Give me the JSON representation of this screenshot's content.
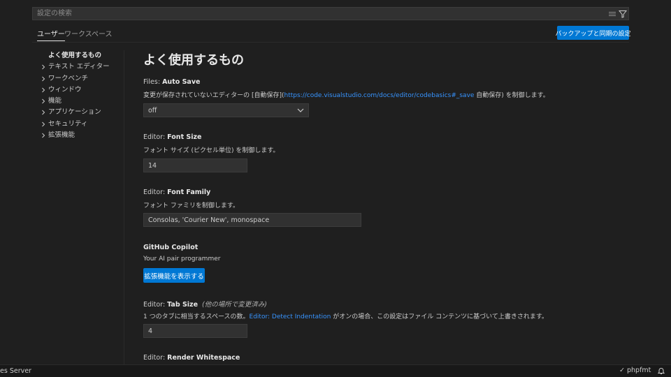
{
  "search": {
    "placeholder": "設定の検索",
    "icons": [
      "list-filter-icon",
      "filter-icon"
    ]
  },
  "tabs": [
    {
      "label": "ユーザー",
      "active": true
    },
    {
      "label": "ワークスペース",
      "active": false
    }
  ],
  "sync_button": "バックアップと同期の設定",
  "toc": {
    "top": "よく使用するもの",
    "items": [
      "テキスト エディター",
      "ワークベンチ",
      "ウィンドウ",
      "機能",
      "アプリケーション",
      "セキュリティ",
      "拡張機能"
    ]
  },
  "page_title": "よく使用するもの",
  "settings": {
    "auto_save": {
      "category": "Files: ",
      "name": "Auto Save",
      "desc_prefix": "変更が保存されていないエディターの [自動保存](",
      "desc_link": "https://code.visualstudio.com/docs/editor/codebasics#_save",
      "desc_suffix": " 自動保存) を制御します。",
      "value": "off"
    },
    "font_size": {
      "category": "Editor: ",
      "name": "Font Size",
      "desc": "フォント サイズ (ピクセル単位) を制御します。",
      "value": "14"
    },
    "font_family": {
      "category": "Editor: ",
      "name": "Font Family",
      "desc": "フォント ファミリを制御します。",
      "value": "Consolas, 'Courier New', monospace"
    },
    "copilot": {
      "name": "GitHub Copilot",
      "desc": "Your AI pair programmer",
      "button": "拡張機能を表示する"
    },
    "tab_size": {
      "category": "Editor: ",
      "name": "Tab Size",
      "modified": "(他の場所で変更済み)",
      "desc_prefix": "1 つのタブに相当するスペースの数。",
      "desc_link": "Editor: Detect Indentation",
      "desc_suffix": " がオンの場合、この設定はファイル コンテンツに基づいて上書きされます。",
      "value": "4"
    },
    "render_whitespace": {
      "category": "Editor: ",
      "name": "Render Whitespace"
    }
  },
  "statusbar": {
    "left": "es Server",
    "right_check": "✓",
    "right_text": "phpfmt",
    "bell_icon": "bell-icon"
  },
  "colors": {
    "accent": "#0078d4",
    "link": "#3794ff",
    "background": "#1f1f1f"
  }
}
